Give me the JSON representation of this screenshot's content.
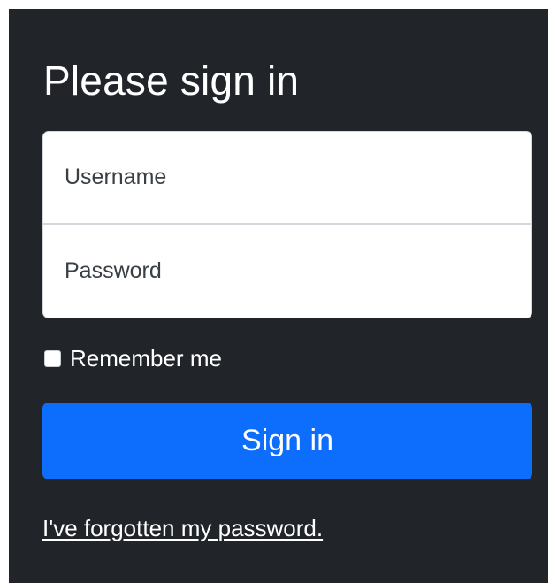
{
  "form": {
    "title": "Please sign in",
    "username": {
      "placeholder": "Username",
      "value": ""
    },
    "password": {
      "placeholder": "Password",
      "value": ""
    },
    "remember": {
      "label": "Remember me",
      "checked": false
    },
    "submit_label": "Sign in",
    "forgot_link": "I've forgotten my password."
  },
  "colors": {
    "panel_background": "#212529",
    "primary": "#0d6efd",
    "text": "#ffffff"
  }
}
